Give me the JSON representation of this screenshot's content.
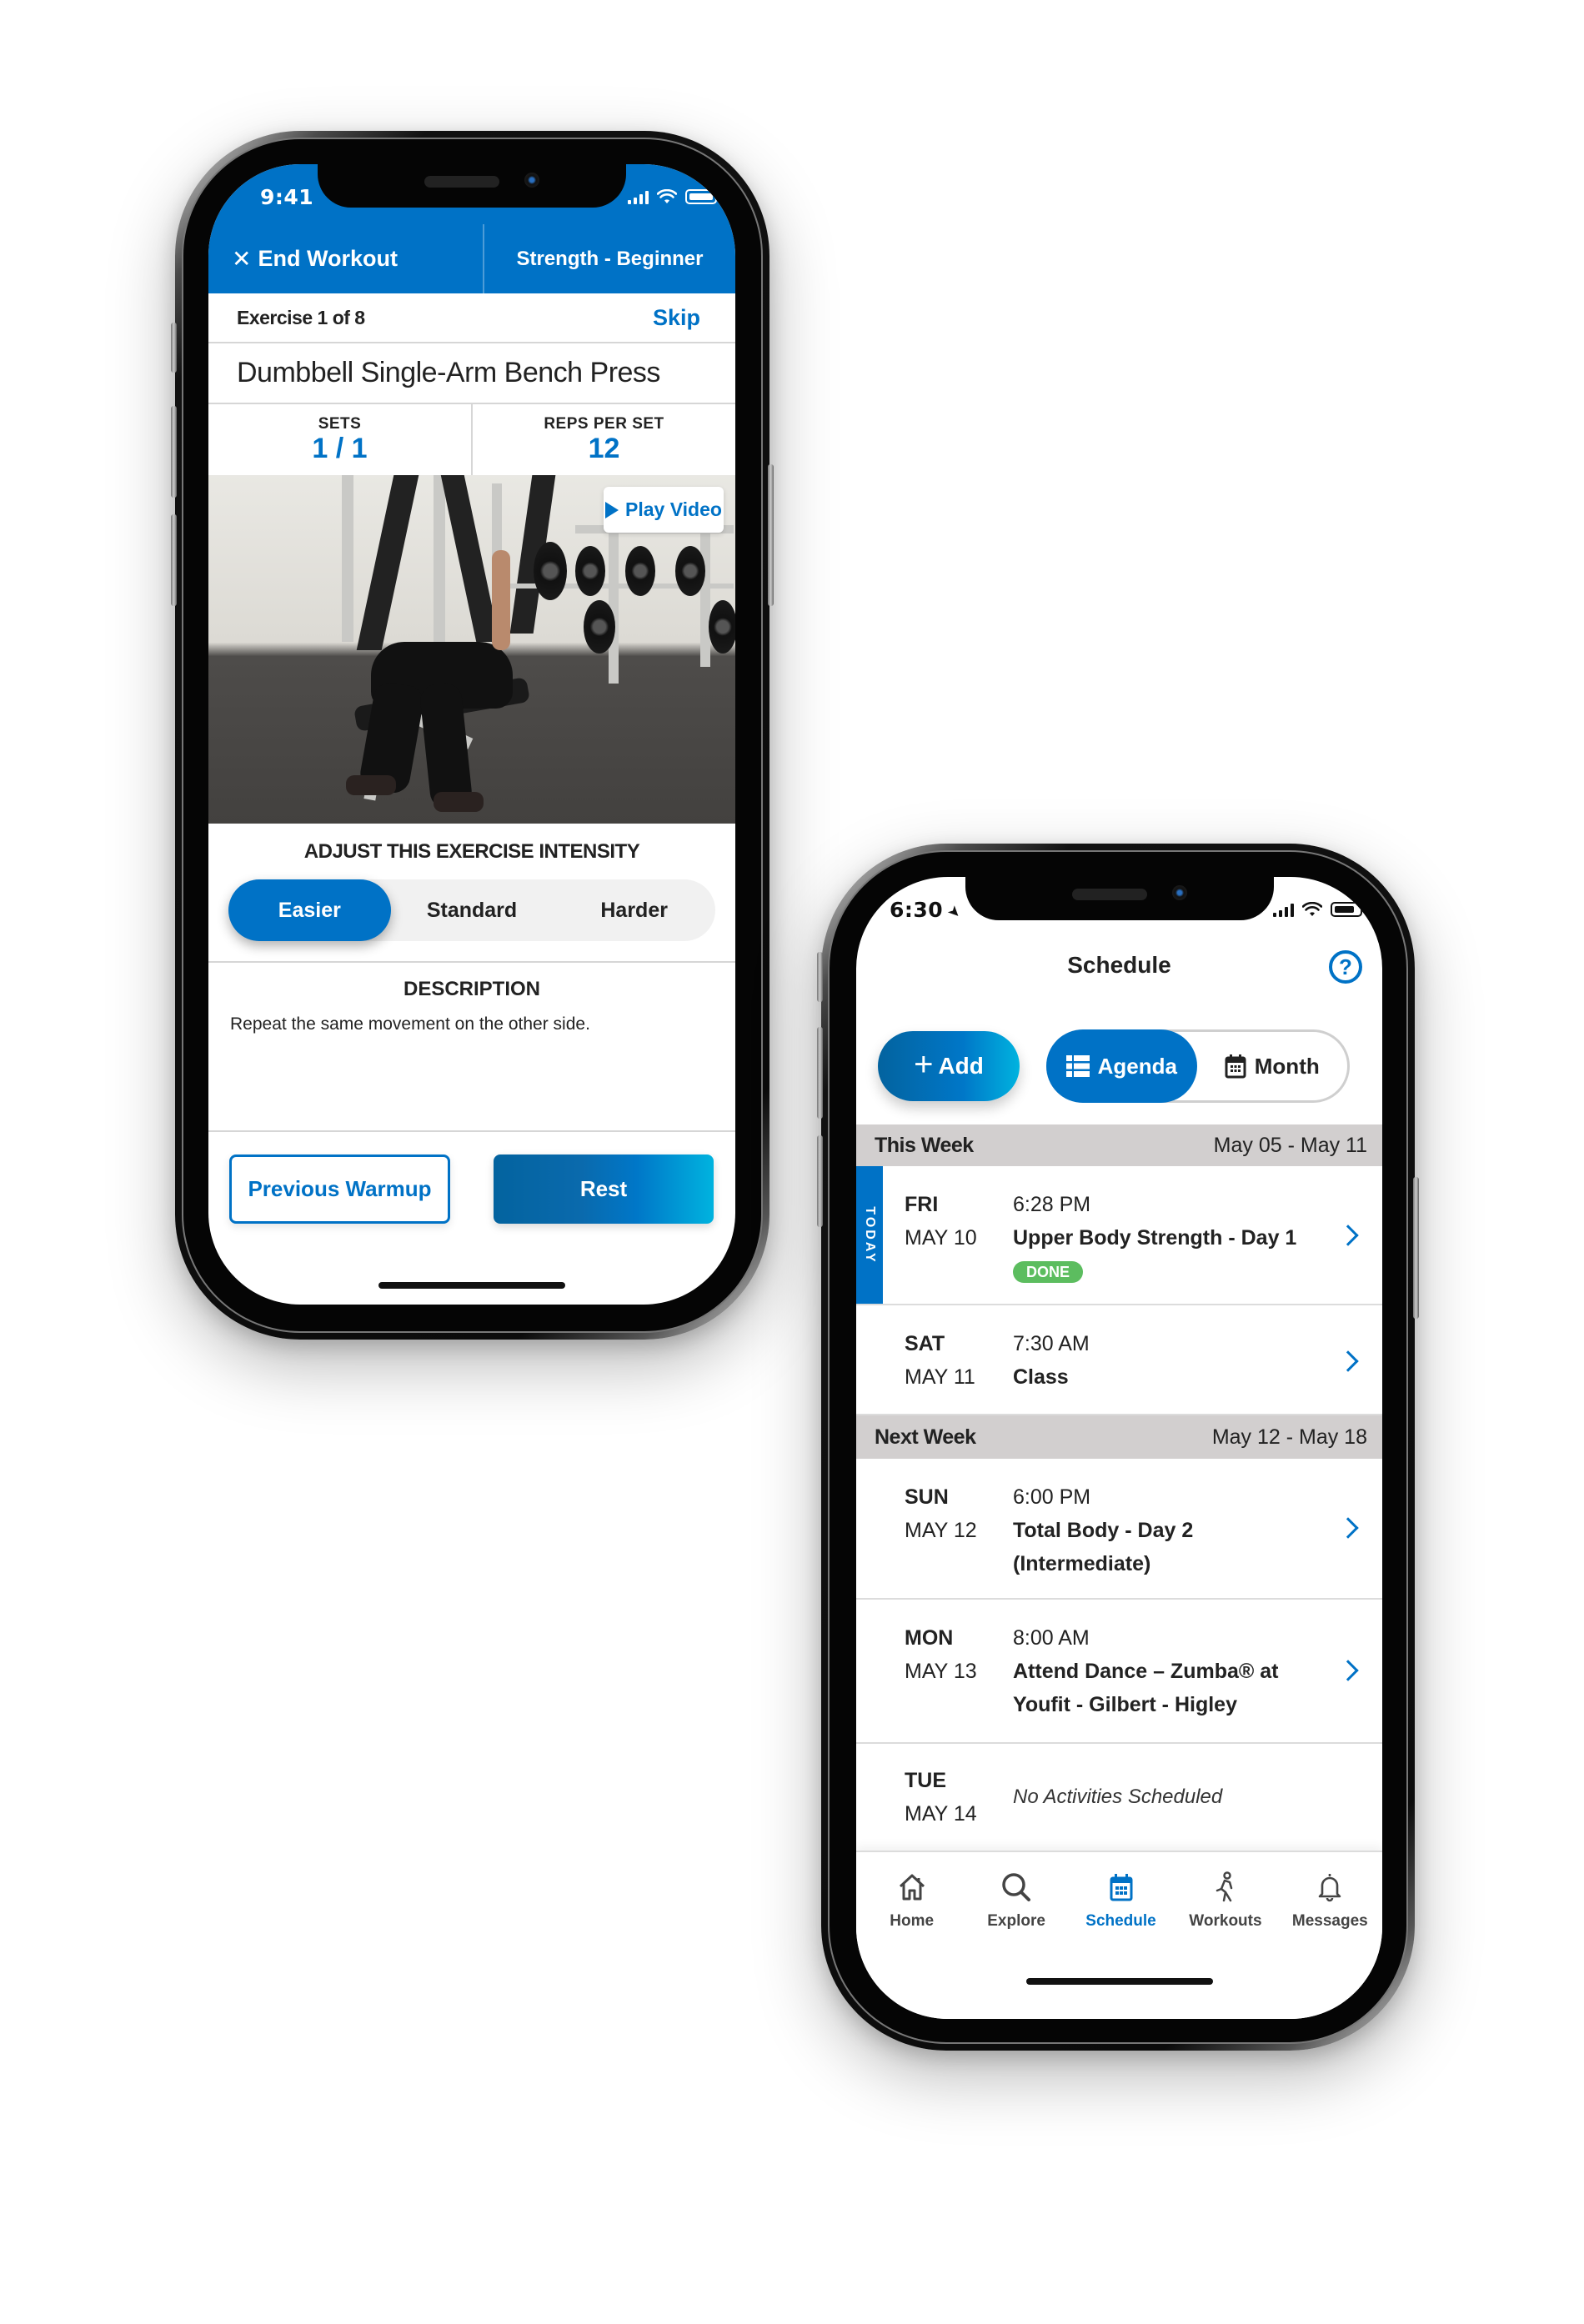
{
  "phone_workout": {
    "status_bar": {
      "time": "9:41"
    },
    "header": {
      "end_workout_label": "End Workout",
      "program_label": "Strength - Beginner"
    },
    "exercise_progress": {
      "label": "Exercise 1 of 8",
      "skip_label": "Skip"
    },
    "exercise_title": "Dumbbell Single-Arm Bench Press",
    "stats": [
      {
        "label": "SETS",
        "value": "1 / 1"
      },
      {
        "label": "REPS PER SET",
        "value": "12"
      }
    ],
    "media": {
      "play_video_label": "Play Video",
      "image_alt": "person performing single-arm dumbbell bench press on a gym bench"
    },
    "intensity": {
      "title": "ADJUST THIS EXERCISE INTENSITY",
      "options": [
        "Easier",
        "Standard",
        "Harder"
      ],
      "selected": "Easier"
    },
    "description": {
      "title": "DESCRIPTION",
      "text": "Repeat the same movement on the other side."
    },
    "buttons": {
      "previous_label": "Previous Warmup",
      "next_label": "Rest"
    },
    "colors": {
      "primary": "#0072c6",
      "gradient_end": "#00b3df"
    }
  },
  "phone_schedule": {
    "status_bar": {
      "time": "6:30"
    },
    "title": "Schedule",
    "add_label": "Add",
    "view_toggle": {
      "options": [
        "Agenda",
        "Month"
      ],
      "selected": "Agenda"
    },
    "weeks": [
      {
        "label": "This Week",
        "range": "May 05 - May 11",
        "days": [
          {
            "dow": "FRI",
            "date": "MAY 10",
            "today": true,
            "today_label": "TODAY",
            "time": "6:28 PM",
            "title": "Upper Body Strength - Day 1",
            "badge": "DONE"
          },
          {
            "dow": "SAT",
            "date": "MAY 11",
            "time": "7:30 AM",
            "title": "Class"
          }
        ]
      },
      {
        "label": "Next Week",
        "range": "May 12 - May 18",
        "days": [
          {
            "dow": "SUN",
            "date": "MAY 12",
            "time": "6:00 PM",
            "title": "Total Body - Day 2 (Intermediate)"
          },
          {
            "dow": "MON",
            "date": "MAY 13",
            "time": "8:00 AM",
            "title": "Attend Dance – Zumba®  at Youfit - Gilbert - Higley"
          },
          {
            "dow": "TUE",
            "date": "MAY 14",
            "empty_text": "No Activities Scheduled"
          }
        ]
      }
    ],
    "tabs": [
      {
        "label": "Home",
        "icon": "home-icon"
      },
      {
        "label": "Explore",
        "icon": "search-icon"
      },
      {
        "label": "Schedule",
        "icon": "calendar-icon",
        "active": true
      },
      {
        "label": "Workouts",
        "icon": "walking-person-icon"
      },
      {
        "label": "Messages",
        "icon": "bell-icon"
      }
    ],
    "colors": {
      "primary": "#0072c6",
      "done": "#5cbd5f",
      "week_header_bg": "#d2cfcf"
    }
  }
}
